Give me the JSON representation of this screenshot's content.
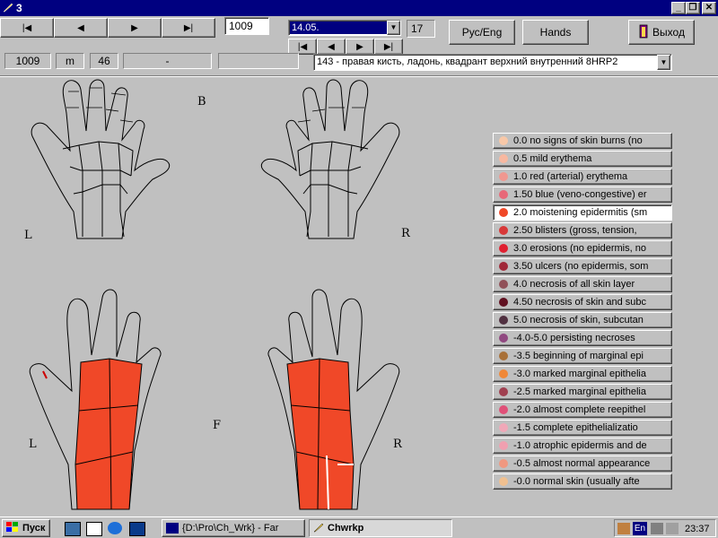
{
  "window": {
    "title": "3",
    "controls": {
      "minimize": "_",
      "restore": "❐",
      "close": "✕"
    }
  },
  "toolbar": {
    "nav_first": "|◀",
    "nav_prev": "◀",
    "nav_next": "▶",
    "nav_last": "▶|",
    "record_id": "1009",
    "date_value": "14.05.",
    "date_count": "17",
    "sub_nav_first": "|◀",
    "sub_nav_prev": "◀",
    "sub_nav_next": "▶",
    "sub_nav_last": "▶|",
    "lang_button": "Рус/Eng",
    "hands_button": "Hands",
    "exit_button": "Выход"
  },
  "info": {
    "patient_id": "1009",
    "sex": "m",
    "age": "46",
    "field3": "-",
    "region_select": "143 - правая кисть, ладонь, квадрант верхний внутренний 8HRP2"
  },
  "diagrams": {
    "back_label": "B",
    "front_label": "F",
    "left_label": "L",
    "right_label": "R",
    "burn_color": "#f04828"
  },
  "legend": [
    {
      "label": "0.0 no signs of skin burns (no",
      "color": "#f8c8a8"
    },
    {
      "label": "0.5 mild erythema",
      "color": "#f8b8a0"
    },
    {
      "label": "1.0 red (arterial) erythema",
      "color": "#f09890"
    },
    {
      "label": "1.50 blue (veno-congestive) er",
      "color": "#e86878"
    },
    {
      "label": "2.0 moistening epidermitis (sm",
      "color": "#f04828",
      "selected": true
    },
    {
      "label": "2.50 blisters (gross, tension,",
      "color": "#d83838"
    },
    {
      "label": "3.0 erosions (no epidermis, no",
      "color": "#e02030"
    },
    {
      "label": "3.50 ulcers (no epidermis, som",
      "color": "#a02838"
    },
    {
      "label": "4.0 necrosis of all skin layer",
      "color": "#905058"
    },
    {
      "label": "4.50 necrosis of skin and subc",
      "color": "#601020"
    },
    {
      "label": "5.0 necrosis of skin, subcutan",
      "color": "#503040"
    },
    {
      "label": "-4.0-5.0 persisting necroses",
      "color": "#904880"
    },
    {
      "label": "-3.5 beginning of marginal epi",
      "color": "#a87038"
    },
    {
      "label": "-3.0 marked marginal epithelia",
      "color": "#f08838"
    },
    {
      "label": "-2.5 marked marginal epithelia",
      "color": "#a04050"
    },
    {
      "label": "-2.0 almost complete reepithel",
      "color": "#e05078"
    },
    {
      "label": "-1.5 complete epithelializatio",
      "color": "#f0a8b8"
    },
    {
      "label": "-1.0 atrophic epidermis and de",
      "color": "#f0a0b0"
    },
    {
      "label": "-0.5 almost normal appearance",
      "color": "#f09880"
    },
    {
      "label": "-0.0 normal skin (usually afte",
      "color": "#f0c090"
    }
  ],
  "taskbar": {
    "start": "Пуск",
    "task1": "{D:\\Pro\\Ch_Wrk} - Far",
    "task2": "Chwrkp",
    "lang": "En",
    "clock": "23:37"
  }
}
